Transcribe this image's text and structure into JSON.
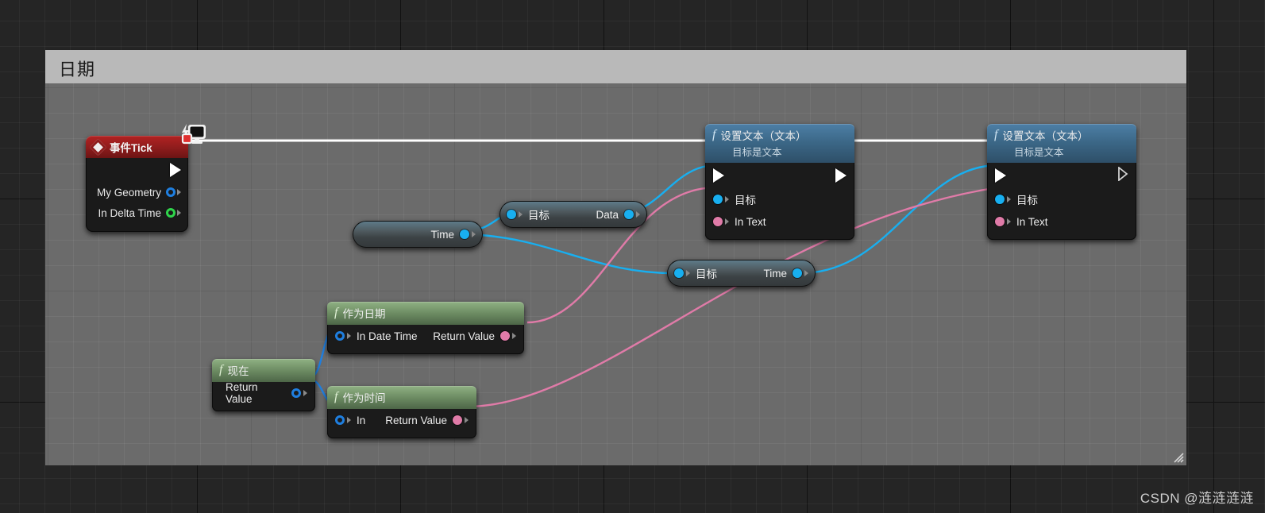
{
  "window": {
    "panel_title": "日期"
  },
  "watermark": "CSDN @涟涟涟涟",
  "colors": {
    "exec_wire": "#ffffff",
    "object_wire": "#18aff0",
    "text_wire": "#e07ba8",
    "event_header": "#8d1c1c",
    "function_header_blue": "#3c6888",
    "function_header_green": "#6d8c63",
    "canvas": "#6b6b6b",
    "titlebar": "#b9b9b9"
  },
  "nodes": {
    "event_tick": {
      "title": "事件Tick",
      "icon": "event-diamond-icon",
      "badge_icon": "screen-lightning-icon",
      "outputs": [
        {
          "label": "",
          "pin": "exec"
        },
        {
          "label": "My Geometry",
          "pin": "struct-blue"
        },
        {
          "label": "In Delta Time",
          "pin": "float-green"
        }
      ]
    },
    "set_text_1": {
      "title": "设置文本（文本）",
      "subtitle": "目标是文本",
      "f_glyph": "f",
      "inputs": [
        {
          "label": "目标",
          "pin": "object"
        },
        {
          "label": "In Text",
          "pin": "text"
        }
      ],
      "exec_in": true,
      "exec_out": true
    },
    "set_text_2": {
      "title": "设置文本（文本）",
      "subtitle": "目标是文本",
      "f_glyph": "f",
      "inputs": [
        {
          "label": "目标",
          "pin": "object"
        },
        {
          "label": "In Text",
          "pin": "text"
        }
      ],
      "exec_in": true,
      "exec_out": false
    },
    "var_time": {
      "label": "Time",
      "pin": "object"
    },
    "var_data": {
      "target_label": "目标",
      "output_label": "Data",
      "pin": "object"
    },
    "var_time2": {
      "target_label": "目标",
      "output_label": "Time",
      "pin": "object"
    },
    "as_date": {
      "title": "作为日期",
      "f_glyph": "f",
      "input_label": "In Date Time",
      "output_label": "Return Value"
    },
    "now": {
      "title": "现在",
      "f_glyph": "f",
      "output_label": "Return Value"
    },
    "as_time": {
      "title": "作为时间",
      "f_glyph": "f",
      "input_label": "In",
      "output_label": "Return Value"
    }
  }
}
